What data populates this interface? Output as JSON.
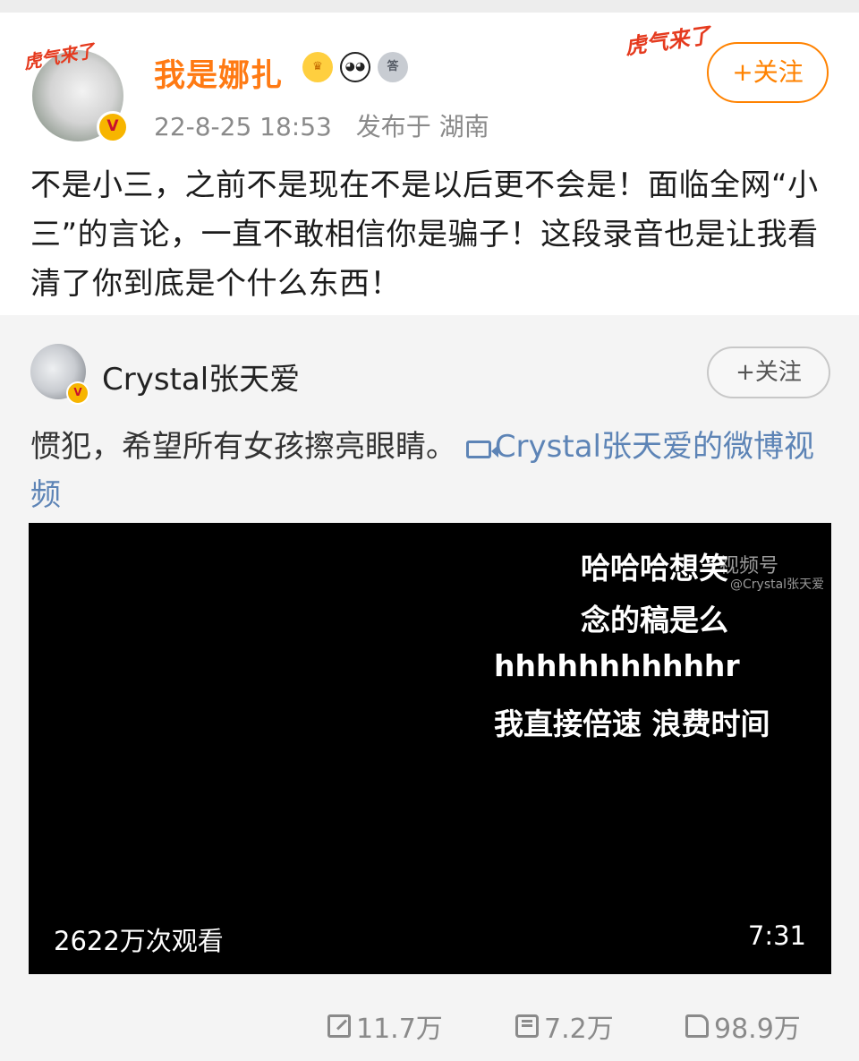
{
  "post": {
    "author": {
      "name": "我是娜扎",
      "tiger_tag": "虎气来了",
      "verified_mark": "V",
      "badges": [
        {
          "name": "crown-icon",
          "glyph": "♛"
        },
        {
          "name": "panda-icon",
          "glyph": "◕◕"
        },
        {
          "name": "medal-icon",
          "glyph": "答"
        }
      ]
    },
    "date": "22-8-25 18:53",
    "location_prefix": "发布于",
    "location": "湖南",
    "follow_deco": "虎气来了",
    "follow_label": "+关注",
    "text": "不是小三，之前不是现在不是以后更不会是！面临全网“小三”的言论，一直不敢相信你是骗子！这段录音也是让我看清了你到底是个什么东西！"
  },
  "repost": {
    "author": {
      "name": "Crystal张天爱",
      "verified_mark": "V"
    },
    "follow_label": "+关注",
    "text": "惯犯，希望所有女孩擦亮眼睛。",
    "link_text": "Crystal张天爱的微博视频",
    "video": {
      "subtitles": [
        "哈哈哈想笑",
        "念的稿是么",
        "hhhhhhhhhhhr",
        "我直接倍速 浪费时间"
      ],
      "watermark": "视频号",
      "watermark_handle": "@Crystal张天爱",
      "views": "2622万次观看",
      "duration": "7:31"
    }
  },
  "actions": {
    "share_count": "11.7万",
    "comment_count": "7.2万",
    "like_count": "98.9万"
  },
  "colors": {
    "brand_orange": "#ff8200",
    "link_blue": "#5d84b6"
  }
}
